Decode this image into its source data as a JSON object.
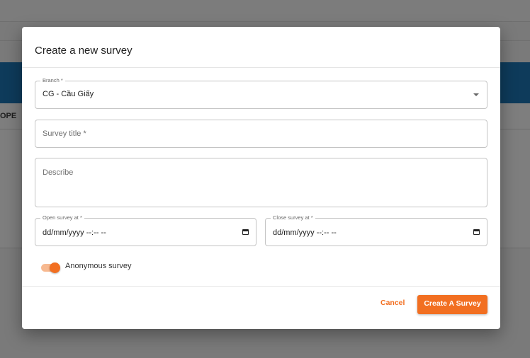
{
  "background": {
    "table_header_fragment": "OPE"
  },
  "modal": {
    "title": "Create a new survey",
    "branch": {
      "label": "Branch *",
      "value": "CG - Cầu Giấy"
    },
    "survey_title": {
      "placeholder": "Survey title *"
    },
    "describe": {
      "placeholder": "Describe"
    },
    "open_at": {
      "label": "Open survey at *",
      "value": "dd/mm/yyyy --:-- --"
    },
    "close_at": {
      "label": "Close survey at *",
      "value": "dd/mm/yyyy --:-- --"
    },
    "anonymous": {
      "label": "Anonymous survey",
      "enabled": true
    },
    "cancel_label": "Cancel",
    "create_label": "Create A Survey"
  },
  "colors": {
    "accent": "#f26f21",
    "header_blue": "#0e3b5b"
  }
}
